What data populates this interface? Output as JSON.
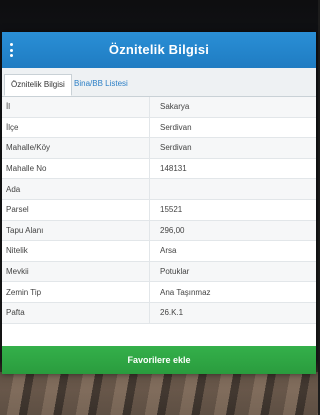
{
  "dialog": {
    "title": "Öznitelik Bilgisi"
  },
  "tabs": [
    {
      "label": "Öznitelik Bilgisi",
      "active": true
    },
    {
      "label": "Bina/BB Listesi",
      "active": false
    }
  ],
  "attributes": [
    {
      "key": "İl",
      "value": "Sakarya"
    },
    {
      "key": "İlçe",
      "value": "Serdivan"
    },
    {
      "key": "Mahalle/Köy",
      "value": "Serdivan"
    },
    {
      "key": "Mahalle No",
      "value": "148131"
    },
    {
      "key": "Ada",
      "value": ""
    },
    {
      "key": "Parsel",
      "value": "15521"
    },
    {
      "key": "Tapu Alanı",
      "value": "296,00"
    },
    {
      "key": "Nitelik",
      "value": "Arsa"
    },
    {
      "key": "Mevkii",
      "value": "Potuklar"
    },
    {
      "key": "Zemin Tip",
      "value": "Ana Taşınmaz"
    },
    {
      "key": "Pafta",
      "value": "26.K.1"
    }
  ],
  "actions": {
    "favorite_label": "Favorilere ekle"
  },
  "colors": {
    "titlebar": "#1f7cc2",
    "tab_link": "#2b7fc6",
    "favorite_button": "#2a9c3e"
  }
}
